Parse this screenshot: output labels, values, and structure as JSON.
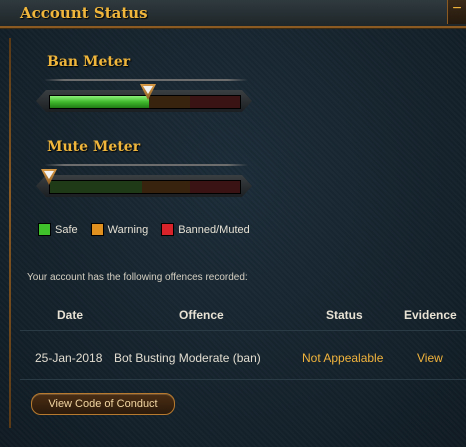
{
  "header": {
    "title": "Account Status",
    "collapse_icon": "minus-icon",
    "collapse_symbol": "−"
  },
  "ban_meter": {
    "title": "Ban Meter",
    "level": 0.52
  },
  "mute_meter": {
    "title": "Mute Meter",
    "level": 0.0
  },
  "legend": [
    {
      "label": "Safe",
      "color": "#3fc12c"
    },
    {
      "label": "Warning",
      "color": "#e0901e"
    },
    {
      "label": "Banned/Muted",
      "color": "#d8232a"
    }
  ],
  "offences_intro": "Your account has the following offences recorded:",
  "table": {
    "headers": [
      "Date",
      "Offence",
      "Status",
      "Evidence"
    ],
    "rows": [
      {
        "date": "25-Jan-2018",
        "offence": "Bot Busting Moderate (ban)",
        "status": "Not Appealable",
        "evidence": "View"
      }
    ]
  },
  "code_of_conduct_button": "View Code of Conduct",
  "colors": {
    "accent": "#f0b63c",
    "link": "#f2b43c",
    "border": "#8a5a22"
  }
}
